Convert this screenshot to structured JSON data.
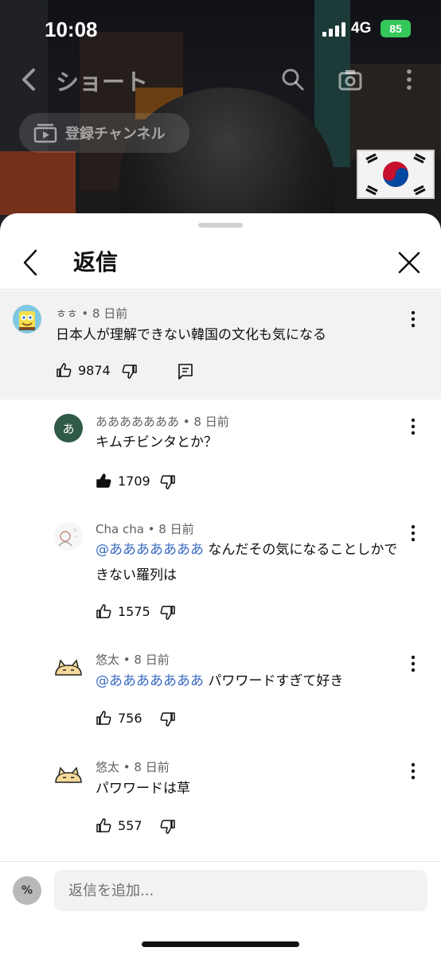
{
  "status": {
    "time": "10:08",
    "network": "4G",
    "battery": "85"
  },
  "top_nav": {
    "title": "ショート",
    "subscriptions_chip": "登録チャンネル"
  },
  "sheet": {
    "title": "返信"
  },
  "parent_comment": {
    "author": "ㅎㅎ",
    "age": "8 日前",
    "text": "日本人が理解できない韓国の文化も気になる",
    "likes": "9874"
  },
  "replies": [
    {
      "author": "あああああああ",
      "age": "8 日前",
      "mention": "",
      "text": "キムチビンタとか？",
      "likes": "1709",
      "liked": true
    },
    {
      "author": "Cha cha",
      "age": "8 日前",
      "mention": "@あああああああ",
      "text": "なんだその気になることしかできない羅列は",
      "likes": "1575",
      "liked": false
    },
    {
      "author": "悠太",
      "age": "8 日前",
      "mention": "@あああああああ",
      "text": "パワワードすぎて好き",
      "likes": "756",
      "liked": false
    },
    {
      "author": "悠太",
      "age": "8 日前",
      "mention": "",
      "text": "パワワードは草",
      "likes": "557",
      "liked": false
    }
  ],
  "avatars": {
    "reply1_letter": "あ",
    "my_avatar": "%"
  },
  "input": {
    "placeholder": "返信を追加..."
  },
  "colors": {
    "mention": "#3b6bc4",
    "battery": "#35c759",
    "parent_bg": "#f2f2f2"
  },
  "icons": [
    "back-icon",
    "search-icon",
    "camera-icon",
    "more-icon",
    "close-icon",
    "like-icon",
    "dislike-icon",
    "reply-icon"
  ]
}
